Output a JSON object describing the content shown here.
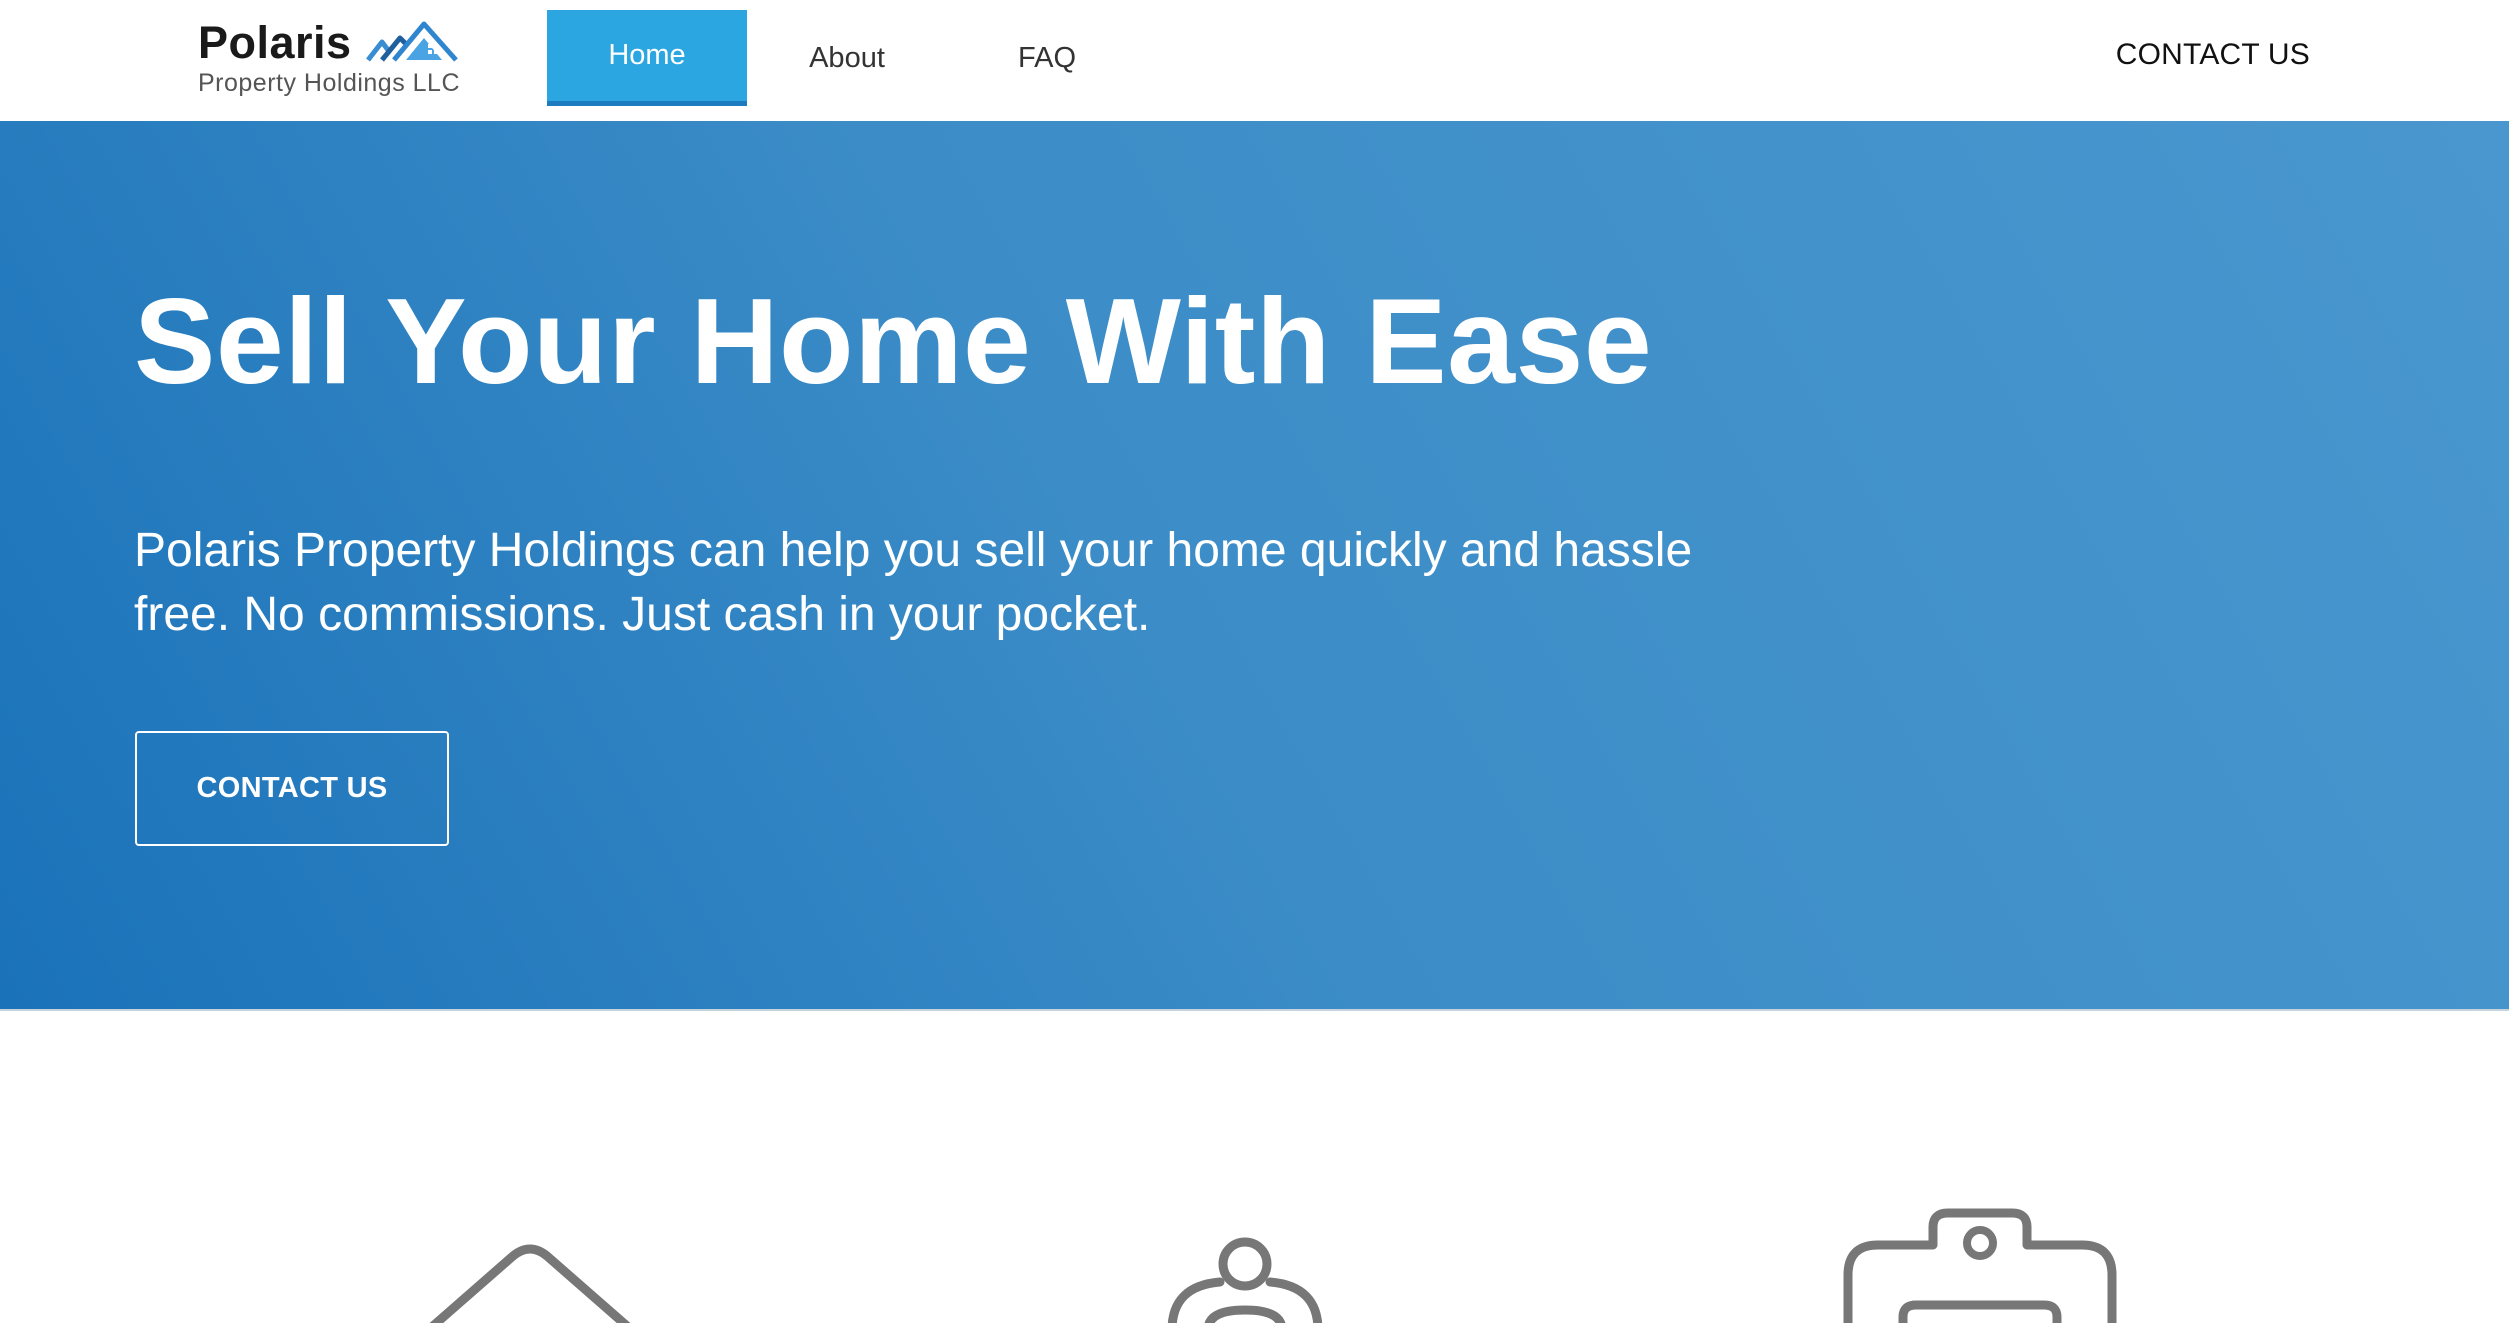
{
  "header": {
    "logo_title": "Polaris",
    "logo_subtitle": "Property Holdings LLC",
    "logo_icon": "house-roof-icon",
    "nav": [
      {
        "label": "Home",
        "active": true
      },
      {
        "label": "About",
        "active": false
      },
      {
        "label": "FAQ",
        "active": false
      }
    ],
    "contact_label": "CONTACT US"
  },
  "hero": {
    "title": "Sell Your Home With Ease",
    "text": "Polaris Property Holdings can help you sell your home quickly and hassle free. No commissions. Just cash in your pocket.",
    "button_label": "CONTACT US"
  },
  "features": {
    "icons": [
      "house-outline-icon",
      "person-outline-icon",
      "clipboard-outline-icon"
    ]
  },
  "colors": {
    "nav_active": "#2ba6e0",
    "hero_gradient_start": "#1a72b9",
    "hero_gradient_end": "#4a97cf",
    "icon_stroke": "#777777"
  }
}
